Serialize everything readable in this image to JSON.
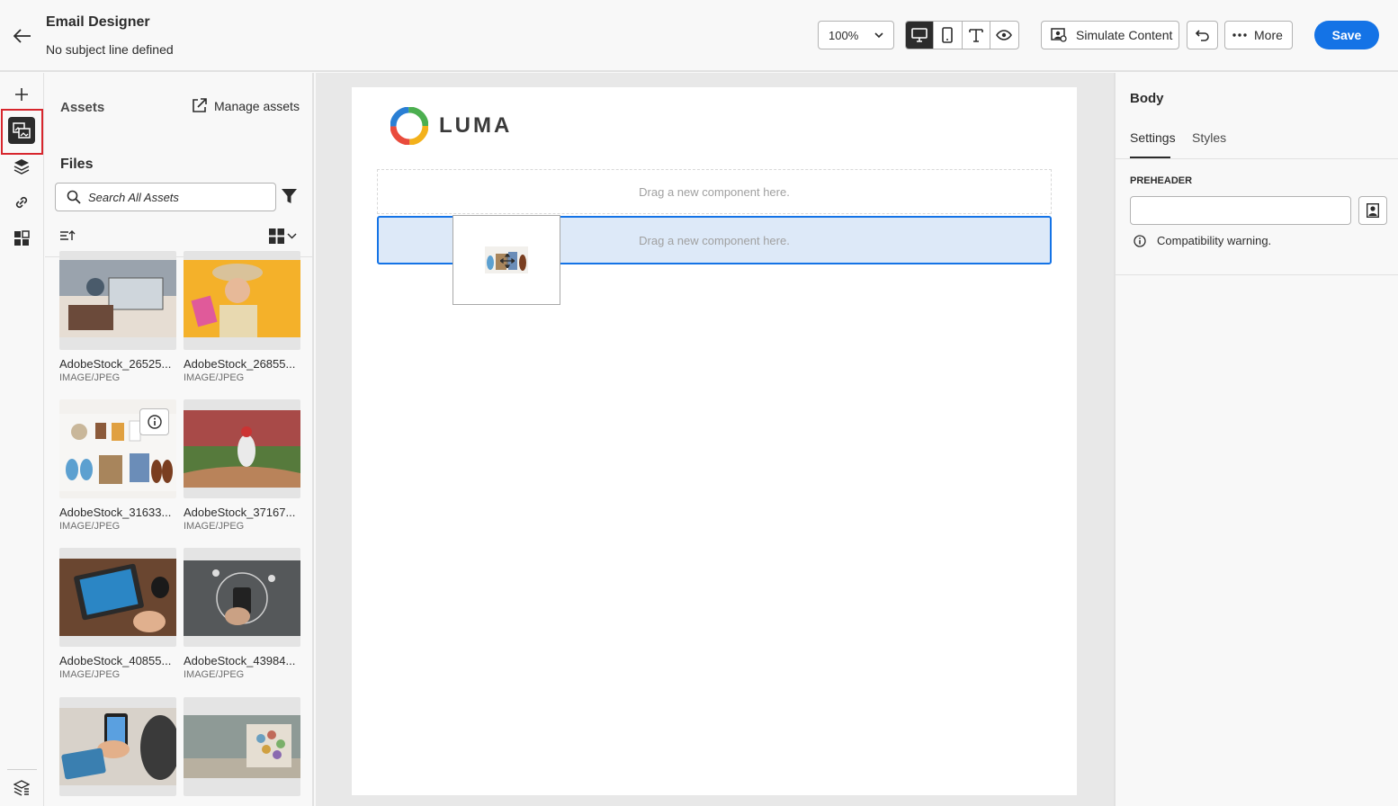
{
  "header": {
    "title": "Email Designer",
    "subtitle": "No subject line defined",
    "zoom": "100%",
    "simulate_label": "Simulate Content",
    "more_label": "More",
    "save_label": "Save"
  },
  "assets": {
    "title": "Assets",
    "manage_label": "Manage assets",
    "files_title": "Files",
    "search_placeholder": "Search All Assets",
    "items": [
      {
        "name": "AdobeStock_26525...",
        "type": "IMAGE/JPEG"
      },
      {
        "name": "AdobeStock_26855...",
        "type": "IMAGE/JPEG"
      },
      {
        "name": "AdobeStock_31633...",
        "type": "IMAGE/JPEG"
      },
      {
        "name": "AdobeStock_37167...",
        "type": "IMAGE/JPEG"
      },
      {
        "name": "AdobeStock_40855...",
        "type": "IMAGE/JPEG"
      },
      {
        "name": "AdobeStock_43984...",
        "type": "IMAGE/JPEG"
      },
      {
        "name": "",
        "type": ""
      },
      {
        "name": "",
        "type": ""
      }
    ]
  },
  "canvas": {
    "logo_text": "LUMA",
    "drop_text_1": "Drag a new component here.",
    "drop_text_2": "Drag a new component here."
  },
  "properties": {
    "title": "Body",
    "tab_settings": "Settings",
    "tab_styles": "Styles",
    "preheader_label": "PREHEADER",
    "preheader_value": "",
    "compat_warning": "Compatibility warning."
  },
  "colors": {
    "accent": "#1473e6",
    "highlight": "#d7262d",
    "dark": "#2c2c2c"
  }
}
